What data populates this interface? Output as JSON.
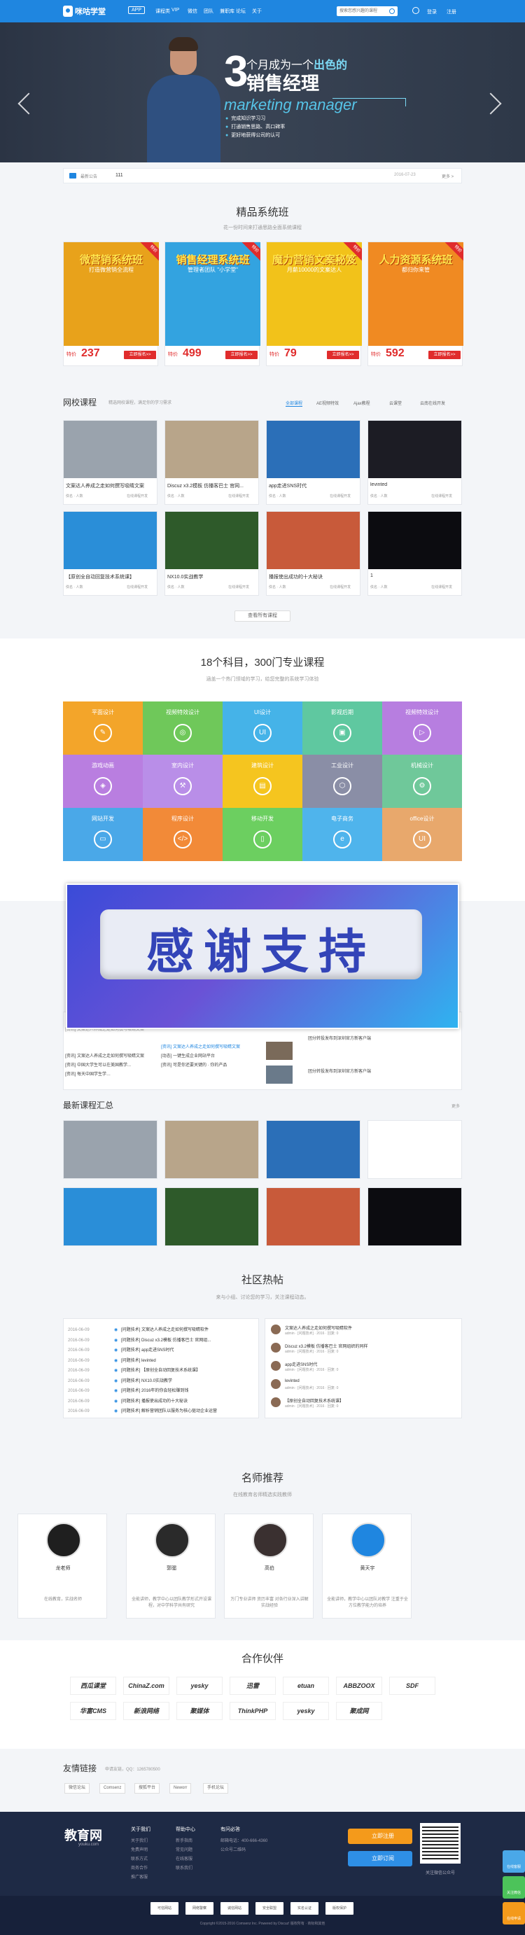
{
  "header": {
    "logo": "咪咕学堂",
    "app_badge": "APP",
    "nav": [
      "课程类",
      "VIP",
      "微信",
      "团队",
      "兼职库",
      "论坛",
      "关于"
    ],
    "search_placeholder": "搜索您感兴趣的课程",
    "login": "登录",
    "register": "注册"
  },
  "banner": {
    "big_num": "3",
    "line1_a": "个月成为一个",
    "line1_b": "出色的",
    "line2": "销售经理",
    "line3": "marketing manager",
    "bullets": [
      "完成知识学习习",
      "打通销售思路、高口碑率",
      "更好地获得公司的认可"
    ]
  },
  "notice": {
    "label": "最新公告",
    "text": "111",
    "date": "2016-07-23",
    "more": "更多 >"
  },
  "featured": {
    "title": "精品系统班",
    "sub": "花一份时间来打通思路全面系统课程",
    "cards": [
      {
        "t1": "微营销系统班",
        "t2": "打造微营销全流程",
        "price_label": "特价",
        "price": "237",
        "btn": "立即报名>>",
        "ribbon": "特价",
        "color": "#e8a21b"
      },
      {
        "t1": "销售经理系统班",
        "t2": "管理者团队 \"小学堂\"",
        "price_label": "特价",
        "price": "499",
        "btn": "立即报名>>",
        "ribbon": "特价",
        "color": "#33a3e0"
      },
      {
        "t1": "魔力营销文案秘笈",
        "t2": "月薪10000的文案达人",
        "price_label": "特价",
        "price": "79",
        "btn": "立即报名>>",
        "ribbon": "特价",
        "color": "#f2c21a"
      },
      {
        "t1": "人力资源系统班",
        "t2": "都归你来管",
        "price_label": "特价",
        "price": "592",
        "btn": "立即报名>>",
        "ribbon": "特价",
        "color": "#f08a22"
      }
    ]
  },
  "courses": {
    "title": "网校课程",
    "sub": "精选网校课程，满足你的学习需求",
    "tabs": [
      "全部课程",
      "AE视频特效",
      "Ajax教程",
      "云课堂",
      "云南在线开发"
    ],
    "items": [
      {
        "name": "文案达人养成之走如何撰写吸睛文案",
        "author": "佚名 · 人数",
        "cat": "在线课程开发"
      },
      {
        "name": "Discuz x3.2模板 仿播客巴士 官网...",
        "author": "佚名 · 人数",
        "cat": "在线课程开发"
      },
      {
        "name": "app走进SNS时代",
        "author": "佚名 · 人数",
        "cat": "在线课程开发"
      },
      {
        "name": "levinted",
        "author": "佚名 · 人数",
        "cat": "在线课程开发"
      },
      {
        "name": "【原创全自动回复技术系统课】",
        "author": "佚名 · 人数",
        "cat": "在线课程开发"
      },
      {
        "name": "NX10.0实战教学",
        "author": "佚名 · 人数",
        "cat": "在线课程开发"
      },
      {
        "name": "播报使出成功的十大秘诀",
        "author": "佚名 · 人数",
        "cat": "在线课程开发"
      },
      {
        "name": "1",
        "author": "佚名 · 人数",
        "cat": "在线课程开发"
      }
    ],
    "more": "查看所有课程"
  },
  "subjects": {
    "title": "18个科目，300门专业课程",
    "sub": "涵盖一个热门领域的学习，给您完整的系统学习体验",
    "items": [
      {
        "label": "平面设计",
        "color": "#f3a52a",
        "icon": "✎"
      },
      {
        "label": "视频特效设计",
        "color": "#6fc85a",
        "icon": "◎"
      },
      {
        "label": "UI设计",
        "color": "#45b3e8",
        "icon": "UI"
      },
      {
        "label": "影视后期",
        "color": "#5fc8a0",
        "icon": "▣"
      },
      {
        "label": "视频特效设计",
        "color": "#b77ee0",
        "icon": "▷"
      },
      {
        "label": "游戏动画",
        "color": "#b97ee0",
        "icon": "◈"
      },
      {
        "label": "室内设计",
        "color": "#b98ee8",
        "icon": "⚒"
      },
      {
        "label": "建筑设计",
        "color": "#f5c51f",
        "icon": "▤"
      },
      {
        "label": "工业设计",
        "color": "#8a8ea6",
        "icon": "⬡"
      },
      {
        "label": "机械设计",
        "color": "#6fc89a",
        "icon": "⚙"
      },
      {
        "label": "网站开发",
        "color": "#4aa8e8",
        "icon": "▭"
      },
      {
        "label": "程序设计",
        "color": "#f28a38",
        "icon": "</>"
      },
      {
        "label": "移动开发",
        "color": "#6ccf60",
        "icon": "▯"
      },
      {
        "label": "电子商务",
        "color": "#4fb4ec",
        "icon": "e"
      },
      {
        "label": "office设计",
        "color": "#e8a86c",
        "icon": "UI"
      }
    ]
  },
  "thanks": {
    "text": "感谢支持"
  },
  "news": {
    "lines": [
      "[资讯] 文案达人养成之走如何撰写吸睛文案",
      "[资讯] 文案达人养成之走如何撰写吸睛文案",
      "[资讯] 中国大学生可以在美国教学...",
      "[资讯] 每天中国学生学…",
      "[动态] 【原创全自动回复技术系统课】",
      "[资讯] 一定要加油 ..."
    ],
    "mid": [
      "[资讯] 文案达人养成之走如何撰写吸睛文案",
      "[动态] 一键生成企业网站平台",
      "[资讯] 可是你还要关键的 · 你的产品"
    ],
    "right1": "团分转投发布到深圳官方新客户端",
    "right2": "团分转投发布到深圳官方新客户端"
  },
  "latest": {
    "title": "最新课程汇总",
    "more": "更多"
  },
  "forum": {
    "title": "社区热帖",
    "sub": "来与小组、讨论您的学习，关注课程动态。",
    "left": [
      {
        "d": "2016-06-09",
        "t": "[问题技术] 文案达人养成之走如何撰写吸睛软件"
      },
      {
        "d": "2016-06-09",
        "t": "[问题技术] Discuz x3.2模板 仿播客巴士 官网组..."
      },
      {
        "d": "2016-06-09",
        "t": "[问题技术] app走进SNS时代"
      },
      {
        "d": "2016-06-09",
        "t": "[问题技术] levinted"
      },
      {
        "d": "2016-06-09",
        "t": "[问题技术] 【原创全自动回复技术系统课】"
      },
      {
        "d": "2016-06-09",
        "t": "[问题技术] NX10.0实战教学"
      },
      {
        "d": "2016-06-09",
        "t": "[问题技术] 2016年的你会轻松赚到钱"
      },
      {
        "d": "2016-06-09",
        "t": "[问题技术] 播报使出成功的十大秘诀"
      },
      {
        "d": "2016-06-09",
        "t": "[问题技术] 解析营销团队以服务为核心驱动企业运营"
      }
    ],
    "right": [
      {
        "t": "文案达人养成之走如何撰写吸睛软件",
        "m": "admin · [问题技术] · 2016 · 回复: 0"
      },
      {
        "t": "Discuz x3.2模板 仿播客巴士 官网组织的同样",
        "m": "admin · [问题技术] · 2016 · 回复: 0"
      },
      {
        "t": "app走进SNS时代",
        "m": "admin · [问题技术] · 2016 · 回复: 0"
      },
      {
        "t": "levinted",
        "m": "admin · [问题技术] · 2016 · 回复: 0"
      },
      {
        "t": "【原创全自动回复技术系统课】",
        "m": "admin · [问题技术] · 2016 · 回复: 0"
      }
    ]
  },
  "teachers": {
    "title": "名师推荐",
    "sub": "在线教育名师精选实践教师",
    "items": [
      {
        "name": "龙老师",
        "desc": "在线教育，实战名师"
      },
      {
        "name": "郭骝",
        "desc": "全能讲师，教学中心以团队教学形式开设课程，对中学科学共有研究"
      },
      {
        "name": "高伯",
        "desc": "万门专业讲师 资历丰富 对各行业深入讲解实战经验"
      },
      {
        "name": "黄天宇",
        "desc": "全能讲师，教学中心以团队对教学 注重于全方位教学能力的培养"
      }
    ]
  },
  "partners": {
    "title": "合作伙伴",
    "items": [
      "西瓜课堂",
      "ChinaZ.com",
      "yesky",
      "迅雷",
      "etuan",
      "ABBZOOX",
      "SDF",
      "华富CMS",
      "新浪网络",
      "聚媒体",
      "ThinkPHP",
      "yesky",
      "聚成网"
    ]
  },
  "links": {
    "title": "友情链接",
    "sub": "申请友链，QQ：1265780500",
    "items": [
      "微信论坛",
      "Comsenz",
      "搜狐平台",
      "Neworr",
      "手机论坛"
    ]
  },
  "footer": {
    "logo": "教育网",
    "domain": "youku.com",
    "cols": [
      {
        "h": "关于我们",
        "items": [
          "关于我们",
          "免费声明",
          "联系方式",
          "商务合作",
          "推广客服"
        ]
      },
      {
        "h": "帮助中心",
        "items": [
          "新手指南",
          "常见问题",
          "在线客服",
          "联系我们"
        ]
      },
      {
        "h": "有问必答",
        "items": [
          "邮箱电话：400-666-4360",
          "公众号二维码"
        ]
      }
    ],
    "btn1": "立即注册",
    "btn2": "立即订阅",
    "qr_cap": "关注微信公众号",
    "copyright": "Copyright ©2015-2016  Comsenz Inc. Powered by Discuz! 版权所有 · 商标和其他",
    "side": [
      "在线客服",
      "关注微信",
      "在线申请"
    ],
    "certs": [
      "可信网站",
      "网络警察",
      "诚信网站",
      "安全联盟",
      "实名认证",
      "版权保护"
    ]
  }
}
